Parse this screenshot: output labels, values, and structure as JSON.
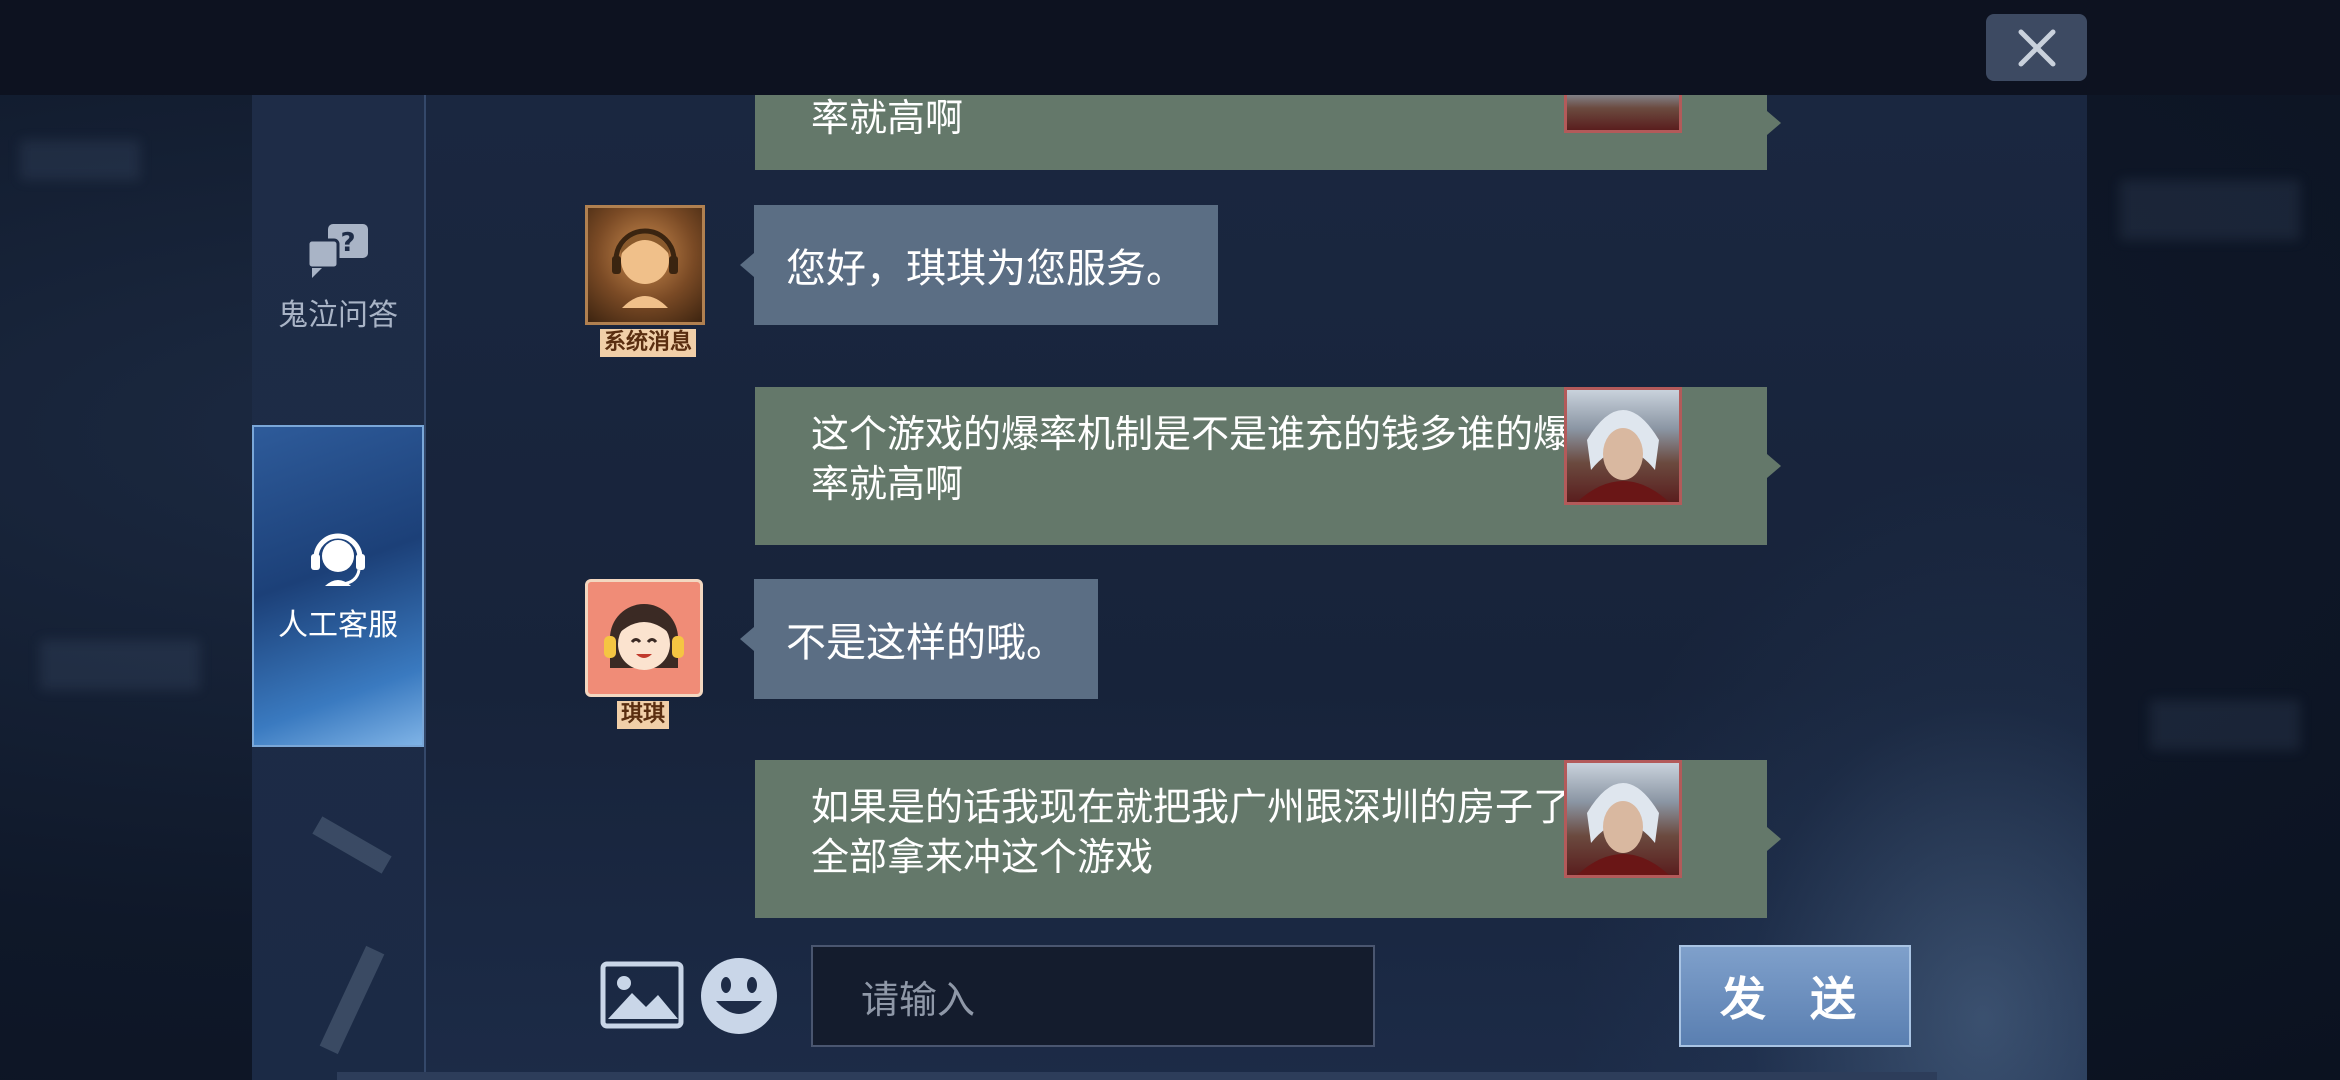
{
  "window": {
    "close_icon": "close-icon"
  },
  "sidebar": {
    "tabs": [
      {
        "label": "鬼泣问答",
        "icon": "question-chat-icon",
        "active": false
      },
      {
        "label": "人工客服",
        "icon": "headset-icon",
        "active": true
      }
    ]
  },
  "chat": {
    "messages": [
      {
        "side": "right",
        "text_lines": [
          "率就高啊"
        ],
        "sender": "user"
      },
      {
        "side": "left",
        "text": "您好，琪琪为您服务。",
        "sender_tag": "系统消息"
      },
      {
        "side": "right",
        "text_lines": [
          "这个游戏的爆率机制是不是谁充的钱多谁的爆",
          "率就高啊"
        ],
        "sender": "user"
      },
      {
        "side": "left",
        "text": "不是这样的哦。",
        "sender_tag": "琪琪"
      },
      {
        "side": "right",
        "text_lines": [
          "如果是的话我现在就把我广州跟深圳的房子了",
          "全部拿来冲这个游戏"
        ],
        "sender": "user"
      }
    ]
  },
  "input": {
    "placeholder": "请输入",
    "send_label": "发 送",
    "image_icon": "image-icon",
    "emoji_icon": "emoji-icon"
  },
  "colors": {
    "user_bubble": "#64786a",
    "agent_bubble": "#5b6e84",
    "send_button": "#6a8dbd"
  }
}
